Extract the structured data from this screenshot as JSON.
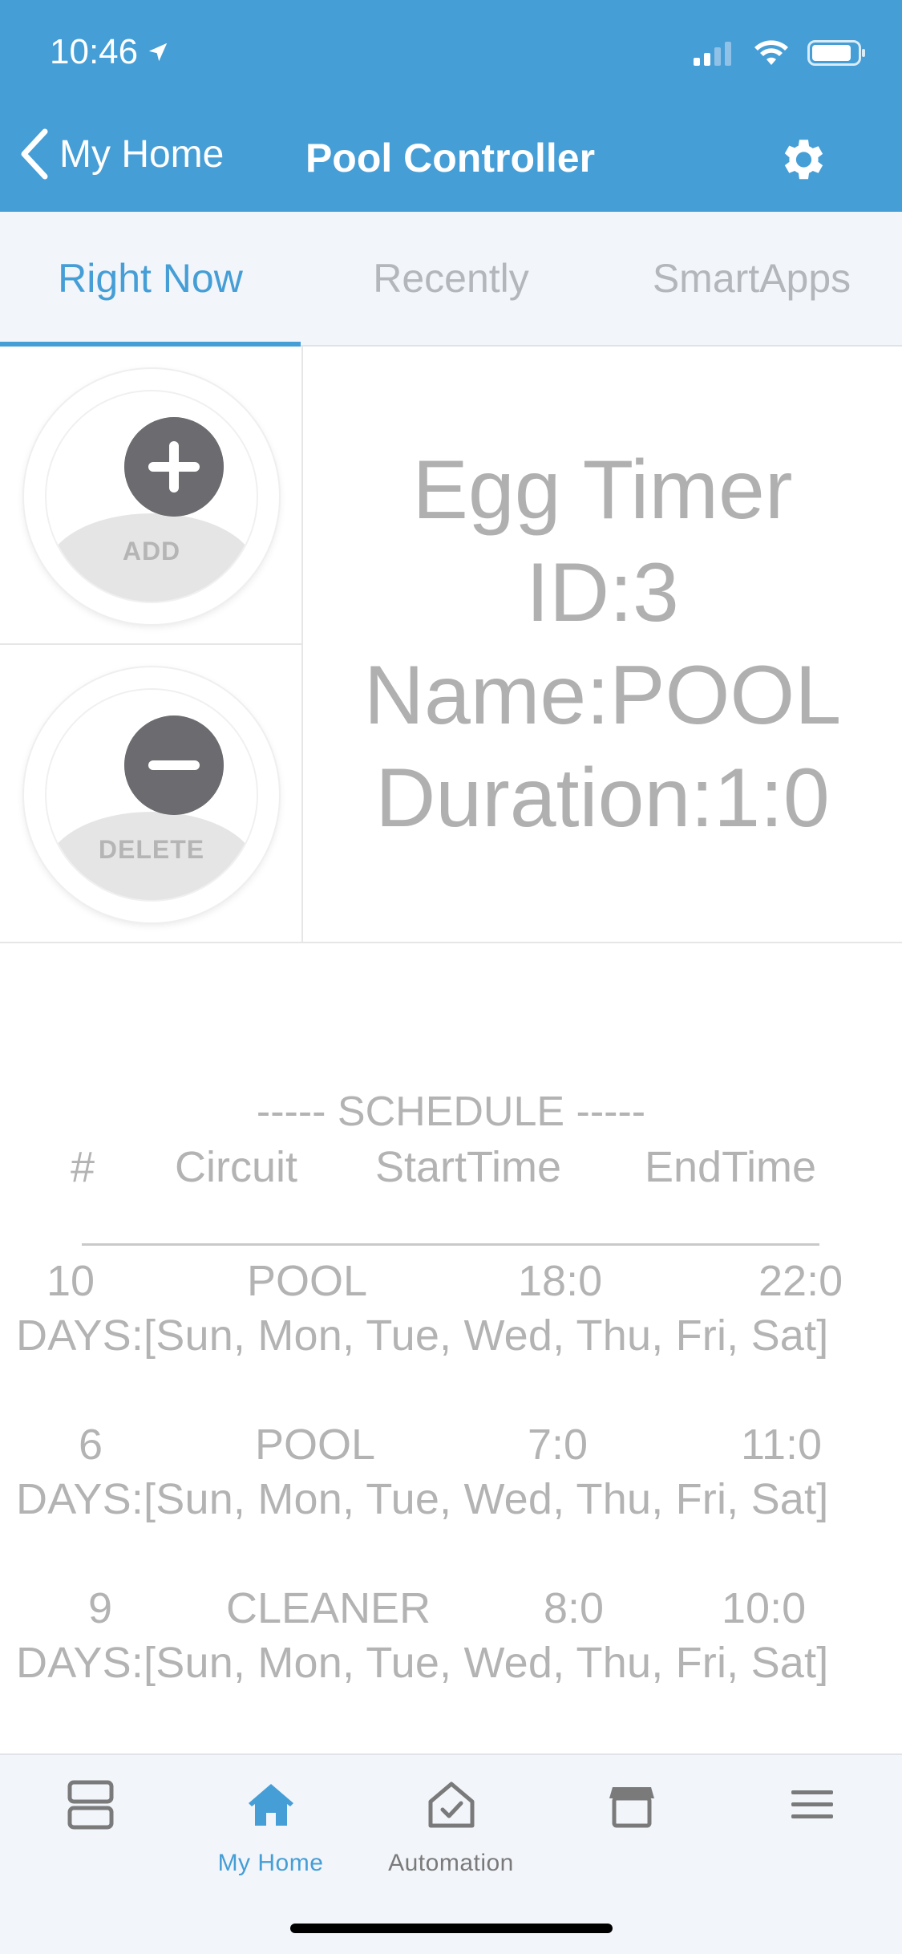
{
  "status_bar": {
    "time": "10:46"
  },
  "nav": {
    "back_label": "My Home",
    "title": "Pool Controller"
  },
  "tabs": [
    {
      "label": "Right Now",
      "active": true
    },
    {
      "label": "Recently",
      "active": false
    },
    {
      "label": "SmartApps",
      "active": false
    }
  ],
  "tiles": {
    "add_label": "ADD",
    "delete_label": "DELETE",
    "info_lines": [
      "Egg Timer",
      "ID:3",
      "Name:POOL",
      "Duration:1:0"
    ]
  },
  "schedule": {
    "title": "----- SCHEDULE -----",
    "headers": {
      "num": "#",
      "circuit": "Circuit",
      "start": "StartTime",
      "end": "EndTime"
    },
    "rows": [
      {
        "num": "10",
        "circuit": "POOL",
        "start": "18:0",
        "end": "22:0",
        "days": "DAYS:[Sun, Mon, Tue, Wed, Thu, Fri, Sat]"
      },
      {
        "num": "6",
        "circuit": "POOL",
        "start": "7:0",
        "end": "11:0",
        "days": "DAYS:[Sun, Mon, Tue, Wed, Thu, Fri, Sat]"
      },
      {
        "num": "9",
        "circuit": "CLEANER",
        "start": "8:0",
        "end": "10:0",
        "days": "DAYS:[Sun, Mon, Tue, Wed, Thu, Fri, Sat]"
      }
    ]
  },
  "bottom_nav": [
    {
      "label": "",
      "icon": "dashboard-icon",
      "active": false
    },
    {
      "label": "My Home",
      "icon": "home-icon",
      "active": true
    },
    {
      "label": "Automation",
      "icon": "automation-icon",
      "active": false
    },
    {
      "label": "",
      "icon": "marketplace-icon",
      "active": false
    },
    {
      "label": "",
      "icon": "menu-icon",
      "active": false
    }
  ],
  "colors": {
    "accent": "#459ed6",
    "header_bg": "#459ed6",
    "text_muted": "#b3b3b3"
  }
}
